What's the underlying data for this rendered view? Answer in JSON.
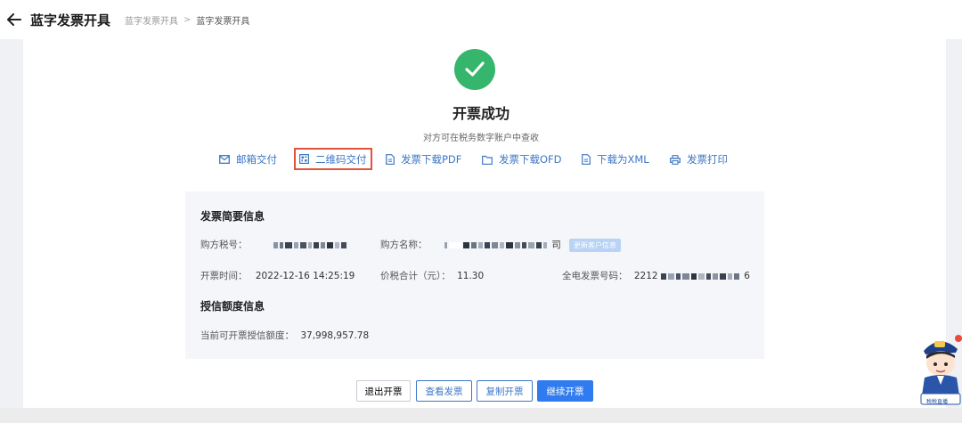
{
  "header": {
    "title": "蓝字发票开具",
    "breadcrumb": [
      "蓝字发票开具",
      "蓝字发票开具"
    ],
    "breadcrumb_sep": ">"
  },
  "result": {
    "title": "开票成功",
    "subtitle": "对方可在税务数字账户中查收"
  },
  "actions": [
    {
      "label": "邮箱交付",
      "icon": "mail-icon"
    },
    {
      "label": "二维码交付",
      "icon": "qrcode-icon"
    },
    {
      "label": "发票下载PDF",
      "icon": "file-icon"
    },
    {
      "label": "发票下载OFD",
      "icon": "file-icon"
    },
    {
      "label": "下载为XML",
      "icon": "file-icon"
    },
    {
      "label": "发票打印",
      "icon": "printer-icon"
    }
  ],
  "summary": {
    "title": "发票简要信息",
    "buyer_tax_label": "购方税号：",
    "buyer_name_label": "购方名称：",
    "buyer_name_suffix": "司",
    "update_tag": "更新客户信息",
    "issue_time_label": "开票时间：",
    "issue_time": "2022-12-16 14:25:19",
    "total_label": "价税合计（元）：",
    "total": "11.30",
    "invoice_no_label": "全电发票号码：",
    "invoice_no_prefix": "2212",
    "invoice_no_suffix": "6"
  },
  "credit": {
    "title": "授信额度信息",
    "label": "当前可开票授信额度：",
    "value": "37,998,957.78"
  },
  "buttons": {
    "exit": "退出开票",
    "view": "查看发票",
    "copy": "复制开票",
    "continue": "继续开票"
  },
  "mascot_caption": "税税直播",
  "colors": {
    "success": "#36b56c",
    "link": "#3e77c5",
    "primary": "#2f7bef",
    "highlight_border": "#e2533b",
    "panel": "#f4f6fa"
  }
}
